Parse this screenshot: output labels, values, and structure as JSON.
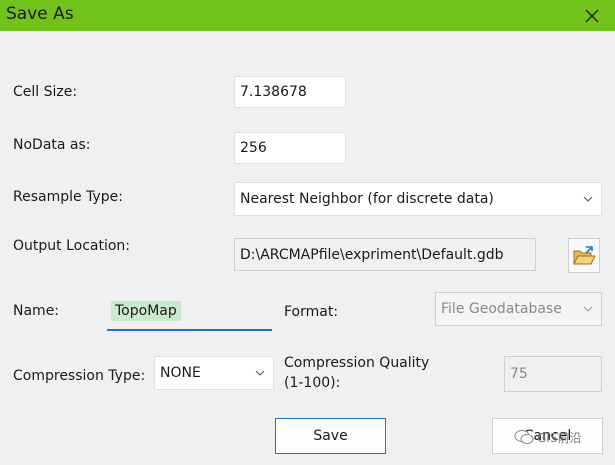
{
  "window": {
    "title": "Save As",
    "accent": "#71c31c"
  },
  "form": {
    "cell_size": {
      "label": "Cell Size:",
      "value": "7.138678"
    },
    "nodata": {
      "label": "NoData as:",
      "value": "256"
    },
    "resample": {
      "label": "Resample Type:",
      "selected": "Nearest Neighbor (for discrete data)"
    },
    "output_location": {
      "label": "Output Location:",
      "value": "D:\\ARCMAPfile\\expriment\\Default.gdb"
    },
    "name": {
      "label": "Name:",
      "value": "TopoMap"
    },
    "format": {
      "label": "Format:",
      "selected": "File Geodatabase"
    },
    "compression_type": {
      "label": "Compression Type:",
      "selected": "NONE"
    },
    "compression_quality": {
      "label_line1": "Compression Quality",
      "label_line2": "(1-100):",
      "value": "75"
    }
  },
  "buttons": {
    "save": "Save",
    "cancel": "Cancel"
  },
  "watermark": {
    "text": "GIS前沿"
  }
}
